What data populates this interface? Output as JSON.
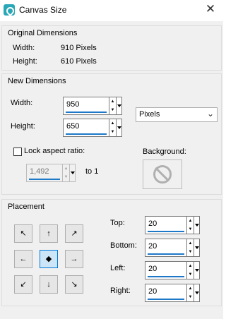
{
  "window": {
    "title": "Canvas Size",
    "close_glyph": "✕"
  },
  "original": {
    "title": "Original Dimensions",
    "width_label": "Width:",
    "width_value": "910 Pixels",
    "height_label": "Height:",
    "height_value": "610 Pixels"
  },
  "new_dims": {
    "title": "New Dimensions",
    "width_label": "Width:",
    "width_value": "950",
    "height_label": "Height:",
    "height_value": "650",
    "units_selected": "Pixels",
    "lock_label": "Lock aspect ratio:",
    "lock_checked": false,
    "ratio_value": "1,492",
    "ratio_suffix": "to 1",
    "background_label": "Background:"
  },
  "placement": {
    "title": "Placement",
    "top_label": "Top:",
    "top_value": "20",
    "bottom_label": "Bottom:",
    "bottom_value": "20",
    "left_label": "Left:",
    "left_value": "20",
    "right_label": "Right:",
    "right_value": "20",
    "selected_anchor": "center",
    "arrows": [
      "↖",
      "↑",
      "↗",
      "←",
      "◆",
      "→",
      "↙",
      "↓",
      "↘"
    ]
  },
  "spin_glyphs": {
    "up": "▲",
    "down": "▼"
  },
  "colors": {
    "accent": "#1e78c8",
    "selected_anchor_bg": "#cde6f7",
    "app_icon": "#2aa7b7"
  }
}
